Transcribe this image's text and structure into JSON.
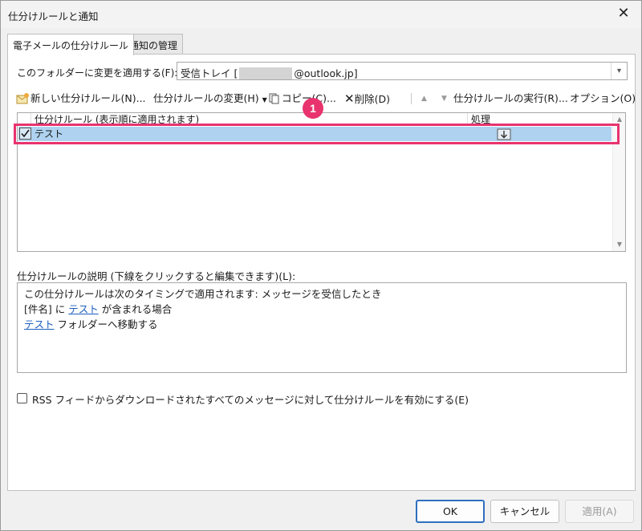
{
  "window": {
    "title": "仕分けルールと通知",
    "close_glyph": "✕"
  },
  "tabs": [
    {
      "label": "電子メールの仕分けルール"
    },
    {
      "label": "通知の管理"
    }
  ],
  "folder": {
    "label": "このフォルダーに変更を適用する(F):",
    "value_prefix": "受信トレイ [",
    "value_suffix": "@outlook.jp]"
  },
  "toolbar": {
    "new_rule": "新しい仕分けルール(N)...",
    "change_rule": "仕分けルールの変更(H)",
    "copy": "コピー(C)...",
    "delete": "削除(D)",
    "run_rules": "仕分けルールの実行(R)...",
    "options": "オプション(O)"
  },
  "rule_list": {
    "columns": [
      "仕分けルール (表示順に適用されます)",
      "処理"
    ],
    "rows": [
      {
        "name": "テスト",
        "checked": true,
        "action_icon": "move-to-folder-icon"
      }
    ]
  },
  "callout": {
    "number": "1"
  },
  "description": {
    "label": "仕分けルールの説明 (下線をクリックすると編集できます)(L):",
    "line1": "この仕分けルールは次のタイミングで適用されます: メッセージを受信したとき",
    "line2_pre": "[件名] に ",
    "line2_link": "テスト",
    "line2_post": " が含まれる場合",
    "line3_link": "テスト",
    "line3_post": " フォルダーへ移動する"
  },
  "rss": {
    "label": "RSS フィードからダウンロードされたすべてのメッセージに対して仕分けルールを有効にする(E)",
    "checked": false
  },
  "buttons": {
    "ok": "OK",
    "cancel": "キャンセル",
    "apply": "適用(A)"
  },
  "colors": {
    "accent": "#e8336e",
    "selection": "#aed2ef",
    "link": "#1f5fbf"
  }
}
